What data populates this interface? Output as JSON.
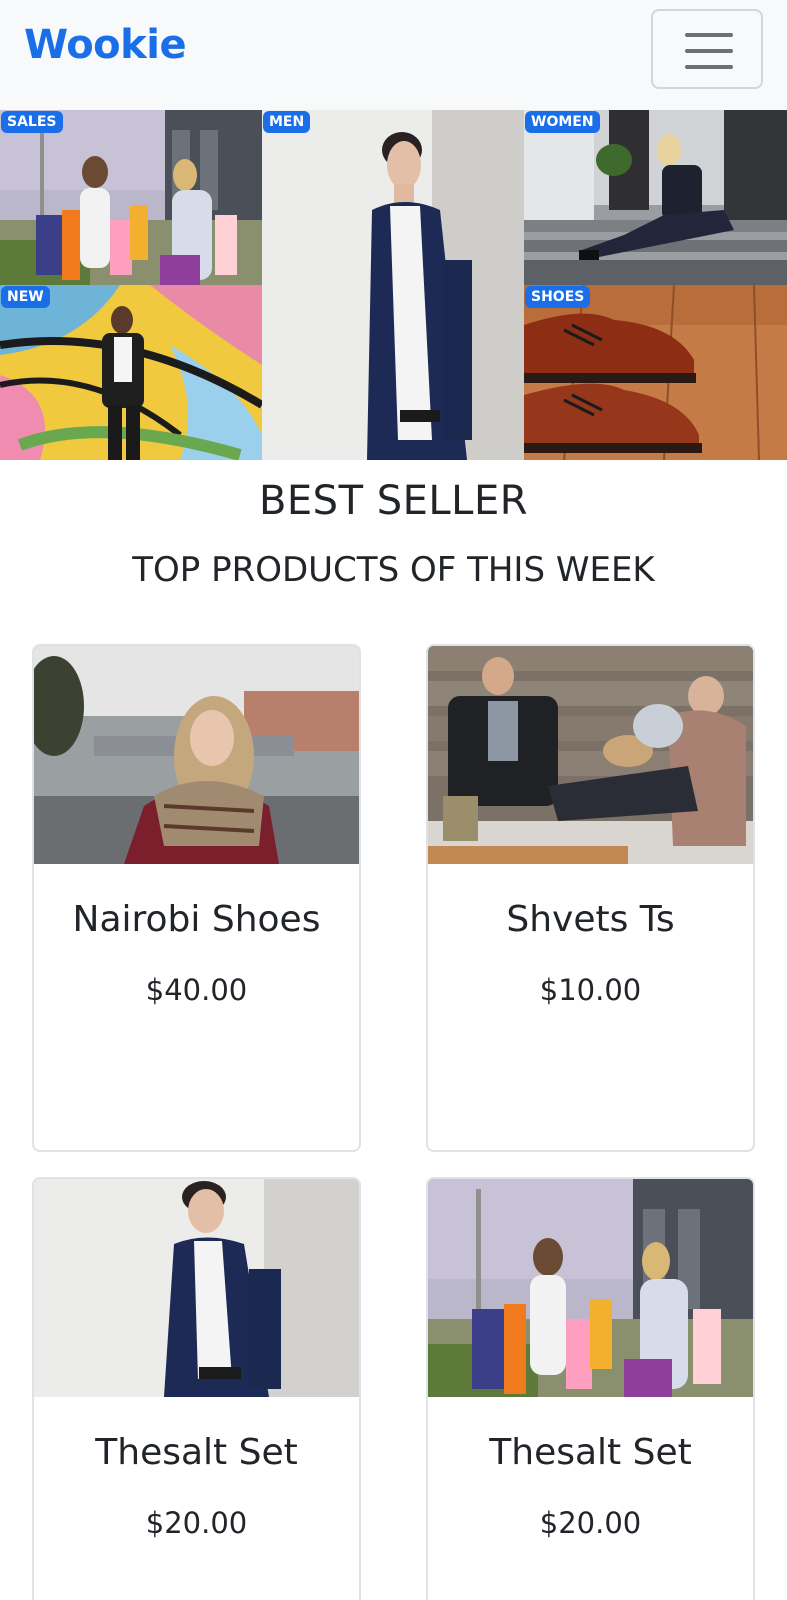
{
  "navbar": {
    "brand": "Wookie",
    "toggle_icon": "hamburger-menu-icon"
  },
  "categories": [
    {
      "label": "SALES",
      "image": "shopping-women-photo"
    },
    {
      "label": "MEN",
      "image": "man-in-suit-photo"
    },
    {
      "label": "WOMEN",
      "image": "woman-sitting-stairs-photo"
    },
    {
      "label": "NEW",
      "image": "woman-graffiti-wall-photo"
    },
    {
      "label": "SHOES",
      "image": "brown-leather-shoes-photo"
    }
  ],
  "section": {
    "title": "BEST SELLER",
    "subtitle": "TOP PRODUCTS OF THIS WEEK"
  },
  "products": [
    {
      "name": "Nairobi Shoes",
      "price": "$40.00",
      "image": "woman-with-scarf-photo"
    },
    {
      "name": "Shvets Ts",
      "price": "$10.00",
      "image": "couple-on-couch-photo"
    },
    {
      "name": "Thesalt Set",
      "price": "$20.00",
      "image": "man-in-suit-photo"
    },
    {
      "name": "Thesalt Set",
      "price": "$20.00",
      "image": "shopping-women-photo"
    }
  ],
  "colors": {
    "brand": "#1a6fe8",
    "navbar_bg": "#f8f9fa",
    "text": "#212529",
    "card_border": "#dfe2e6"
  }
}
